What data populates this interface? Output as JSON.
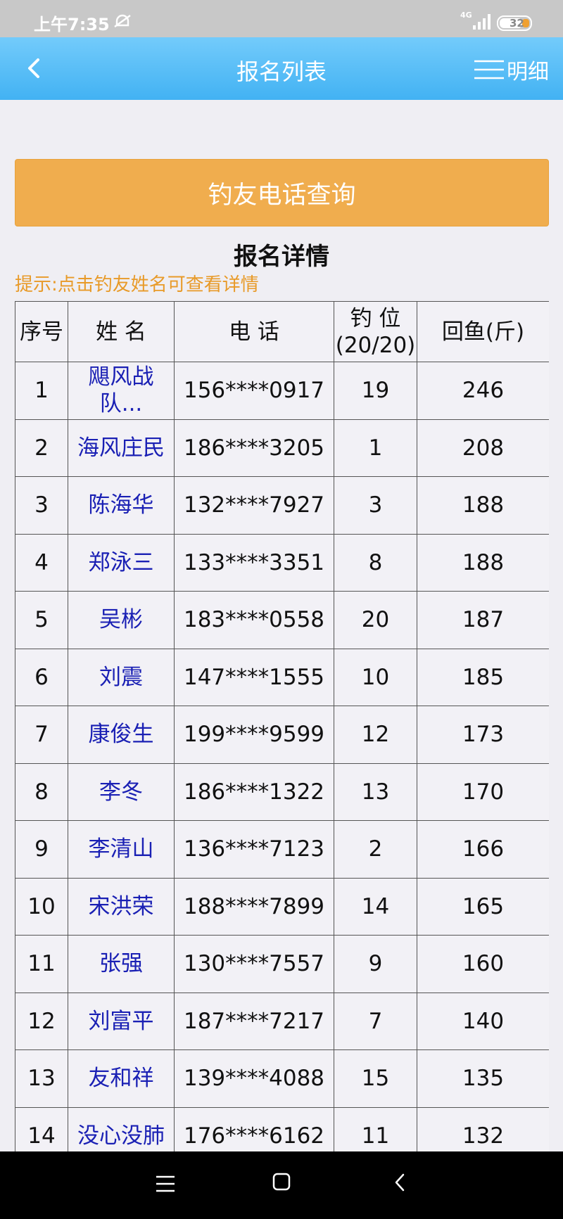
{
  "status": {
    "time": "上午7:35",
    "network": "4G",
    "battery": "32"
  },
  "header": {
    "title": "报名列表",
    "detail_label": "明细"
  },
  "query_button": "钓友电话查询",
  "section_title": "报名详情",
  "hint": "提示:点击钓友姓名可查看详情",
  "table": {
    "headers": {
      "index": "序号",
      "name": "姓 名",
      "phone": "电 话",
      "spot_line1": "钓 位",
      "spot_line2": "(20/20)",
      "catch": "回鱼(斤)"
    },
    "rows": [
      {
        "index": "1",
        "name": "飓风战队...",
        "phone": "156****0917",
        "spot": "19",
        "catch": "246"
      },
      {
        "index": "2",
        "name": "海风庄民",
        "phone": "186****3205",
        "spot": "1",
        "catch": "208"
      },
      {
        "index": "3",
        "name": "陈海华",
        "phone": "132****7927",
        "spot": "3",
        "catch": "188"
      },
      {
        "index": "4",
        "name": "郑泳三",
        "phone": "133****3351",
        "spot": "8",
        "catch": "188"
      },
      {
        "index": "5",
        "name": "吴彬",
        "phone": "183****0558",
        "spot": "20",
        "catch": "187"
      },
      {
        "index": "6",
        "name": "刘震",
        "phone": "147****1555",
        "spot": "10",
        "catch": "185"
      },
      {
        "index": "7",
        "name": "康俊生",
        "phone": "199****9599",
        "spot": "12",
        "catch": "173"
      },
      {
        "index": "8",
        "name": "李冬",
        "phone": "186****1322",
        "spot": "13",
        "catch": "170"
      },
      {
        "index": "9",
        "name": "李清山",
        "phone": "136****7123",
        "spot": "2",
        "catch": "166"
      },
      {
        "index": "10",
        "name": "宋洪荣",
        "phone": "188****7899",
        "spot": "14",
        "catch": "165"
      },
      {
        "index": "11",
        "name": "张强",
        "phone": "130****7557",
        "spot": "9",
        "catch": "160"
      },
      {
        "index": "12",
        "name": "刘富平",
        "phone": "187****7217",
        "spot": "7",
        "catch": "140"
      },
      {
        "index": "13",
        "name": "友和祥",
        "phone": "139****4088",
        "spot": "15",
        "catch": "135"
      },
      {
        "index": "14",
        "name": "没心没肺",
        "phone": "176****6162",
        "spot": "11",
        "catch": "132"
      }
    ]
  },
  "icons": {
    "back": "chevron-left-icon",
    "menu": "menu-icon",
    "mute": "bell-off-icon",
    "nav_menu": "menu-icon",
    "nav_home": "square-icon",
    "nav_back": "chevron-left-icon"
  },
  "colors": {
    "header": "#42b2f3",
    "query_button": "#f0ad4e",
    "hint": "#e89a28",
    "name_link": "#1a20b4"
  }
}
